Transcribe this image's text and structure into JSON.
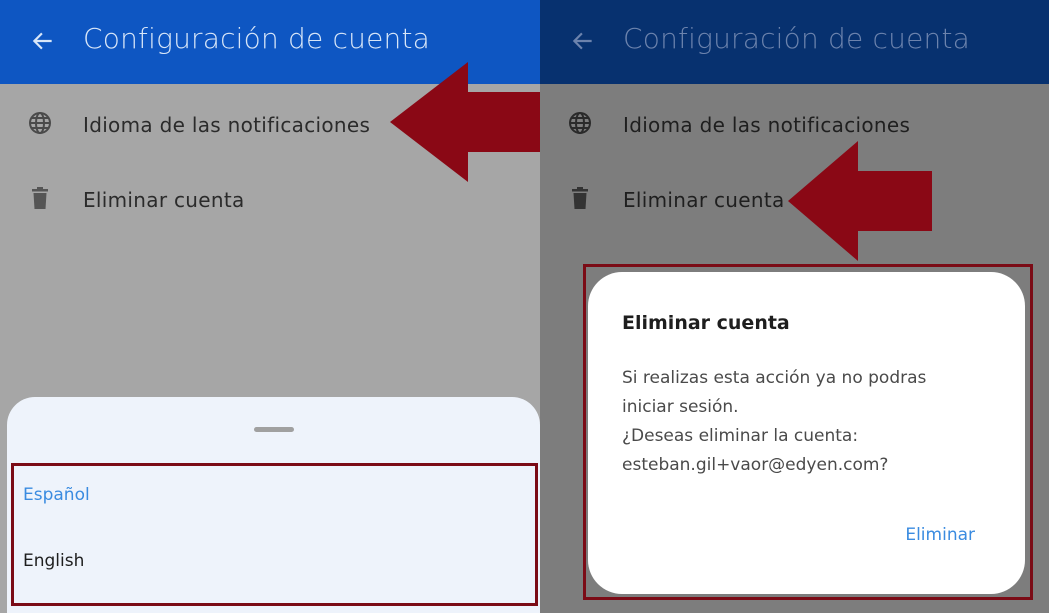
{
  "colors": {
    "appbar_left": "#0e56c2",
    "appbar_right": "#07316f",
    "selected_option": "#3a8be0",
    "annotation": "#8a0815",
    "dialog_button": "#3a8be0"
  },
  "left_screen": {
    "appbar": {
      "title": "Configuración de cuenta",
      "back_icon": "arrow-left-icon"
    },
    "settings": [
      {
        "label": "Idioma de las notificaciones",
        "icon": "globe-icon"
      },
      {
        "label": "Eliminar cuenta",
        "icon": "trash-icon"
      }
    ],
    "language_sheet": {
      "options": [
        {
          "label": "Español",
          "selected": true
        },
        {
          "label": "English",
          "selected": false
        }
      ]
    }
  },
  "right_screen": {
    "appbar": {
      "title": "Configuración de cuenta",
      "back_icon": "arrow-left-icon"
    },
    "settings": [
      {
        "label": "Idioma de las notificaciones",
        "icon": "globe-icon"
      },
      {
        "label": "Eliminar cuenta",
        "icon": "trash-icon"
      }
    ],
    "dialog": {
      "title": "Eliminar cuenta",
      "body_lines": [
        "Si realizas esta acción ya no podras",
        "iniciar sesión.",
        "¿Deseas eliminar la cuenta:",
        "esteban.gil+vaor@edyen.com?"
      ],
      "confirm_label": "Eliminar"
    }
  }
}
